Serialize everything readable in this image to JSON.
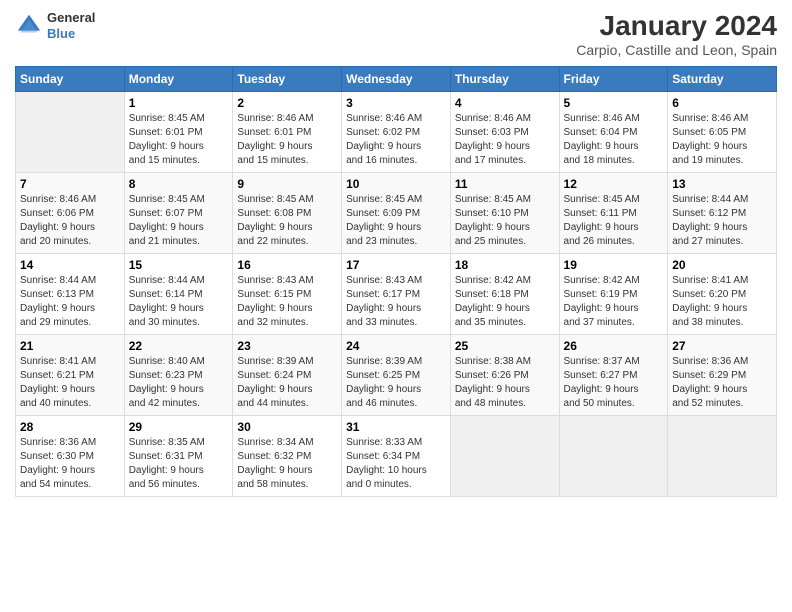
{
  "header": {
    "logo_line1": "General",
    "logo_line2": "Blue",
    "month": "January 2024",
    "location": "Carpio, Castille and Leon, Spain"
  },
  "weekdays": [
    "Sunday",
    "Monday",
    "Tuesday",
    "Wednesday",
    "Thursday",
    "Friday",
    "Saturday"
  ],
  "weeks": [
    [
      {
        "day": "",
        "info": ""
      },
      {
        "day": "1",
        "info": "Sunrise: 8:45 AM\nSunset: 6:01 PM\nDaylight: 9 hours\nand 15 minutes."
      },
      {
        "day": "2",
        "info": "Sunrise: 8:46 AM\nSunset: 6:01 PM\nDaylight: 9 hours\nand 15 minutes."
      },
      {
        "day": "3",
        "info": "Sunrise: 8:46 AM\nSunset: 6:02 PM\nDaylight: 9 hours\nand 16 minutes."
      },
      {
        "day": "4",
        "info": "Sunrise: 8:46 AM\nSunset: 6:03 PM\nDaylight: 9 hours\nand 17 minutes."
      },
      {
        "day": "5",
        "info": "Sunrise: 8:46 AM\nSunset: 6:04 PM\nDaylight: 9 hours\nand 18 minutes."
      },
      {
        "day": "6",
        "info": "Sunrise: 8:46 AM\nSunset: 6:05 PM\nDaylight: 9 hours\nand 19 minutes."
      }
    ],
    [
      {
        "day": "7",
        "info": "Sunrise: 8:46 AM\nSunset: 6:06 PM\nDaylight: 9 hours\nand 20 minutes."
      },
      {
        "day": "8",
        "info": "Sunrise: 8:45 AM\nSunset: 6:07 PM\nDaylight: 9 hours\nand 21 minutes."
      },
      {
        "day": "9",
        "info": "Sunrise: 8:45 AM\nSunset: 6:08 PM\nDaylight: 9 hours\nand 22 minutes."
      },
      {
        "day": "10",
        "info": "Sunrise: 8:45 AM\nSunset: 6:09 PM\nDaylight: 9 hours\nand 23 minutes."
      },
      {
        "day": "11",
        "info": "Sunrise: 8:45 AM\nSunset: 6:10 PM\nDaylight: 9 hours\nand 25 minutes."
      },
      {
        "day": "12",
        "info": "Sunrise: 8:45 AM\nSunset: 6:11 PM\nDaylight: 9 hours\nand 26 minutes."
      },
      {
        "day": "13",
        "info": "Sunrise: 8:44 AM\nSunset: 6:12 PM\nDaylight: 9 hours\nand 27 minutes."
      }
    ],
    [
      {
        "day": "14",
        "info": "Sunrise: 8:44 AM\nSunset: 6:13 PM\nDaylight: 9 hours\nand 29 minutes."
      },
      {
        "day": "15",
        "info": "Sunrise: 8:44 AM\nSunset: 6:14 PM\nDaylight: 9 hours\nand 30 minutes."
      },
      {
        "day": "16",
        "info": "Sunrise: 8:43 AM\nSunset: 6:15 PM\nDaylight: 9 hours\nand 32 minutes."
      },
      {
        "day": "17",
        "info": "Sunrise: 8:43 AM\nSunset: 6:17 PM\nDaylight: 9 hours\nand 33 minutes."
      },
      {
        "day": "18",
        "info": "Sunrise: 8:42 AM\nSunset: 6:18 PM\nDaylight: 9 hours\nand 35 minutes."
      },
      {
        "day": "19",
        "info": "Sunrise: 8:42 AM\nSunset: 6:19 PM\nDaylight: 9 hours\nand 37 minutes."
      },
      {
        "day": "20",
        "info": "Sunrise: 8:41 AM\nSunset: 6:20 PM\nDaylight: 9 hours\nand 38 minutes."
      }
    ],
    [
      {
        "day": "21",
        "info": "Sunrise: 8:41 AM\nSunset: 6:21 PM\nDaylight: 9 hours\nand 40 minutes."
      },
      {
        "day": "22",
        "info": "Sunrise: 8:40 AM\nSunset: 6:23 PM\nDaylight: 9 hours\nand 42 minutes."
      },
      {
        "day": "23",
        "info": "Sunrise: 8:39 AM\nSunset: 6:24 PM\nDaylight: 9 hours\nand 44 minutes."
      },
      {
        "day": "24",
        "info": "Sunrise: 8:39 AM\nSunset: 6:25 PM\nDaylight: 9 hours\nand 46 minutes."
      },
      {
        "day": "25",
        "info": "Sunrise: 8:38 AM\nSunset: 6:26 PM\nDaylight: 9 hours\nand 48 minutes."
      },
      {
        "day": "26",
        "info": "Sunrise: 8:37 AM\nSunset: 6:27 PM\nDaylight: 9 hours\nand 50 minutes."
      },
      {
        "day": "27",
        "info": "Sunrise: 8:36 AM\nSunset: 6:29 PM\nDaylight: 9 hours\nand 52 minutes."
      }
    ],
    [
      {
        "day": "28",
        "info": "Sunrise: 8:36 AM\nSunset: 6:30 PM\nDaylight: 9 hours\nand 54 minutes."
      },
      {
        "day": "29",
        "info": "Sunrise: 8:35 AM\nSunset: 6:31 PM\nDaylight: 9 hours\nand 56 minutes."
      },
      {
        "day": "30",
        "info": "Sunrise: 8:34 AM\nSunset: 6:32 PM\nDaylight: 9 hours\nand 58 minutes."
      },
      {
        "day": "31",
        "info": "Sunrise: 8:33 AM\nSunset: 6:34 PM\nDaylight: 10 hours\nand 0 minutes."
      },
      {
        "day": "",
        "info": ""
      },
      {
        "day": "",
        "info": ""
      },
      {
        "day": "",
        "info": ""
      }
    ]
  ]
}
